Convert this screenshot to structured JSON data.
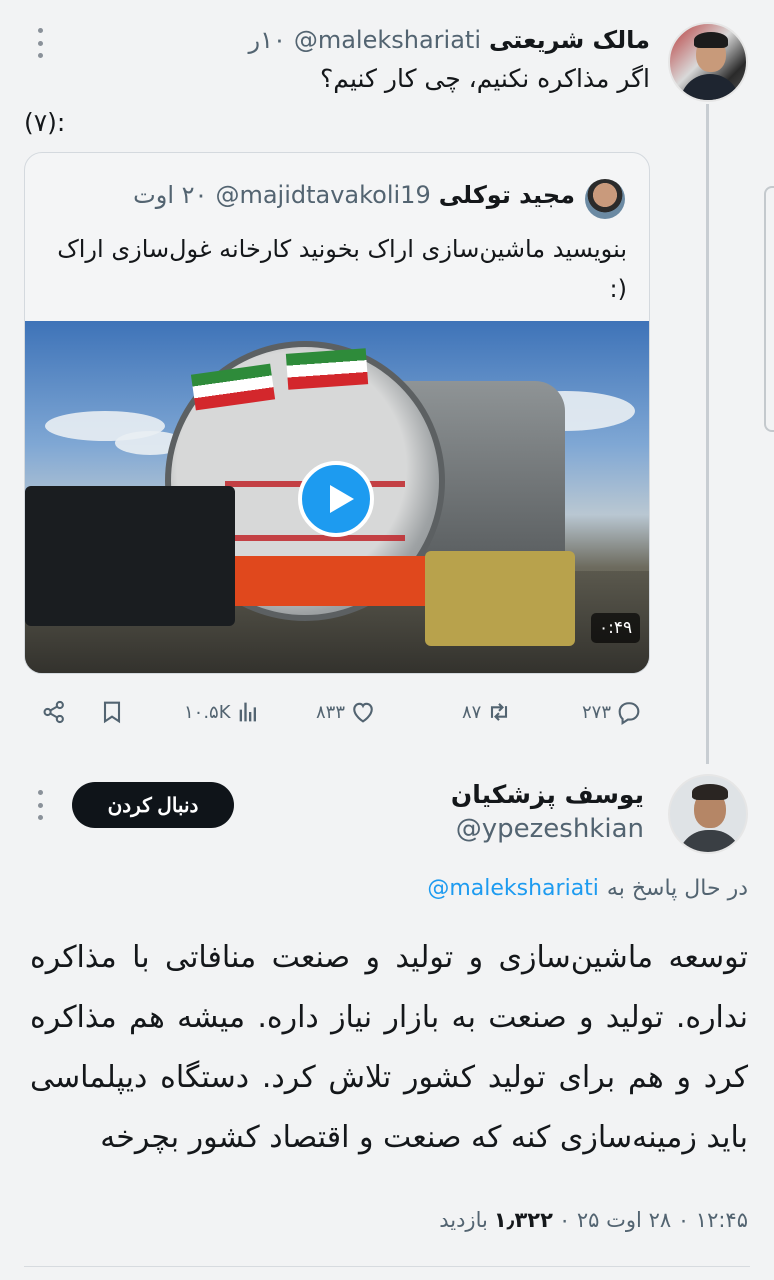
{
  "tweet1": {
    "name": "مالک شریعتی",
    "handle": "@malekshariati",
    "time": "۱۰ر",
    "text": "اگر مذاکره نکنیم، چی کار کنیم؟",
    "text2": "(۷):",
    "quote": {
      "name": "مجید توکلی",
      "handle": "@majidtavakoli19",
      "time": "۲۰ اوت",
      "text": "بنویسید ماشین‌سازی اراک بخونید کارخانه غول‌سازی اراک (:",
      "video_duration": "۰:۴۹"
    },
    "actions": {
      "replies": "۲۷۳",
      "retweets": "۸۷",
      "likes": "۸۳۳",
      "views": "۱۰.۵K"
    }
  },
  "tweet2": {
    "name": "یوسف پزشکیان",
    "handle": "@ypezeshkian",
    "follow_label": "دنبال کردن",
    "reply_prefix": "در حال پاسخ به",
    "reply_to": "@malekshariati",
    "body": "توسعه ماشین‌سازی و تولید و صنعت منافاتی با مذاکره نداره. تولید و صنعت به بازار نیاز داره. میشه هم مذاکره کرد و هم برای تولید کشور تلاش کرد. دستگاه دیپلماسی باید زمینه‌سازی کنه که صنعت و اقتصاد کشور بچرخه",
    "timestamp": "۱۲:۴۵ ۰ ۲۸ اوت ۲۵ ۰",
    "views_count": "۱٫۳۲۲",
    "views_label": "بازدید"
  },
  "colors": {
    "accent": "#1d9bf0",
    "text": "#14171a",
    "muted": "#536471",
    "background": "#f2f3f4"
  }
}
